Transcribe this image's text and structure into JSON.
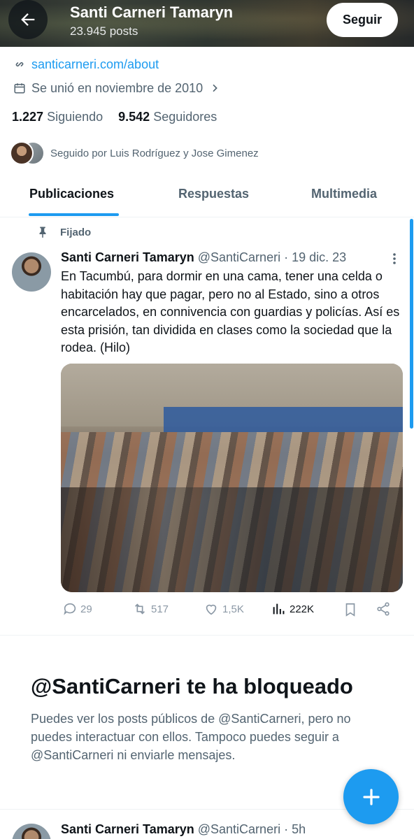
{
  "header": {
    "name": "Santi Carneri Tamaryn",
    "posts_count": "23.945 posts",
    "follow_label": "Seguir"
  },
  "profile": {
    "website": "santicarneri.com/about",
    "joined": "Se unió en noviembre de 2010",
    "following_count": "1.227",
    "following_label": "Siguiendo",
    "followers_count": "9.542",
    "followers_label": "Seguidores",
    "followed_by": "Seguido por Luis Rodríguez y Jose Gimenez"
  },
  "tabs": [
    {
      "label": "Publicaciones",
      "active": true
    },
    {
      "label": "Respuestas",
      "active": false
    },
    {
      "label": "Multimedia",
      "active": false
    }
  ],
  "pinned_tweet": {
    "pinned_label": "Fijado",
    "author": "Santi Carneri Tamaryn",
    "handle": "@SantiCarneri",
    "date": "· 19 dic. 23",
    "text": "En Tacumbú, para dormir en una cama, tener una celda o habitación hay que pagar, pero no al Estado, sino a otros encarcelados, en connivencia con guardias y policías. Así es esta prisión, tan dividida en clases como la sociedad que la rodea. (Hilo)",
    "replies": "29",
    "reposts": "517",
    "likes": "1,5K",
    "views": "222K"
  },
  "blocked_notice": {
    "title": "@SantiCarneri te ha bloqueado",
    "body": "Puedes ver los posts públicos de @SantiCarneri, pero no puedes interactuar con ellos. Tampoco puedes seguir a @SantiCarneri ni enviarle mensajes."
  },
  "next_tweet": {
    "author": "Santi Carneri Tamaryn",
    "handle": "@SantiCarneri",
    "date": "· 5h"
  },
  "colors": {
    "accent": "#1d9bf0",
    "text_primary": "#0f1419",
    "text_secondary": "#536471"
  },
  "icons": [
    "back-arrow-icon",
    "link-icon",
    "calendar-icon",
    "chevron-right-icon",
    "pin-icon",
    "more-icon",
    "reply-icon",
    "repost-icon",
    "like-icon",
    "views-icon",
    "bookmark-icon",
    "share-icon",
    "plus-icon"
  ]
}
